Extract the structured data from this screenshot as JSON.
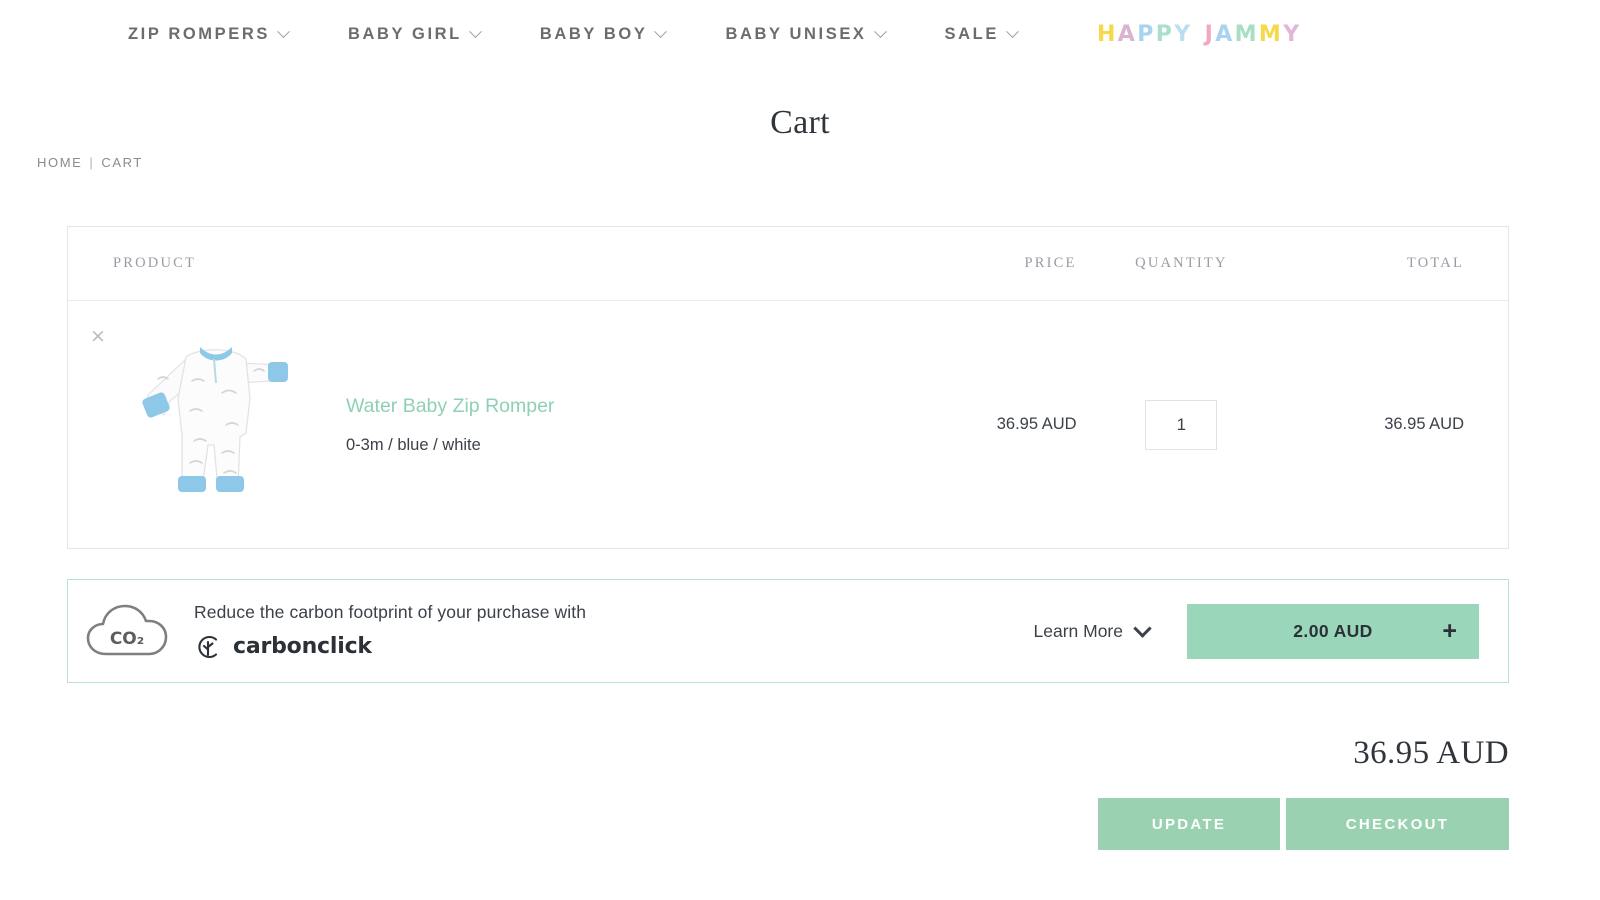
{
  "nav": {
    "items": [
      {
        "label": "ZIP ROMPERS",
        "has_dropdown": true,
        "icon": "chevron-down-icon"
      },
      {
        "label": "BABY GIRL",
        "has_dropdown": true,
        "icon": "chevron-down-icon"
      },
      {
        "label": "BABY BOY",
        "has_dropdown": true,
        "icon": "chevron-down-icon"
      },
      {
        "label": "BABY UNISEX",
        "has_dropdown": true,
        "icon": "chevron-down-icon"
      },
      {
        "label": "SALE",
        "has_dropdown": true,
        "icon": "chevron-down-icon"
      }
    ],
    "brand": {
      "word1": "HAPPY",
      "word2": "JAMMY",
      "letters": [
        {
          "ch": "H",
          "color": "#f5d94b"
        },
        {
          "ch": "A",
          "color": "#d9b3cf"
        },
        {
          "ch": "P",
          "color": "#a8d3ef"
        },
        {
          "ch": "P",
          "color": "#a8e0c9"
        },
        {
          "ch": "Y",
          "color": "#b9dff0"
        },
        {
          "ch": "J",
          "color": "#f2a8be"
        },
        {
          "ch": "A",
          "color": "#a8d3ef"
        },
        {
          "ch": "M",
          "color": "#a8ddc6"
        },
        {
          "ch": "M",
          "color": "#f5d94b"
        },
        {
          "ch": "Y",
          "color": "#e0b7d6"
        }
      ]
    }
  },
  "page": {
    "title": "Cart"
  },
  "breadcrumb": {
    "home": "HOME",
    "separator": "|",
    "current": "CART"
  },
  "cart": {
    "columns": {
      "product": "PRODUCT",
      "price": "PRICE",
      "quantity": "QUANTITY",
      "total": "TOTAL"
    },
    "items": [
      {
        "remove_icon": "close-icon",
        "remove_label": "×",
        "image_alt": "Water Baby Zip Romper thumbnail",
        "name": "Water Baby Zip Romper",
        "variant": "0-3m / blue / white",
        "price": "36.95 AUD",
        "quantity": "1",
        "line_total": "36.95 AUD"
      }
    ]
  },
  "carbon": {
    "icon": "co2-cloud-icon",
    "cloud_label": "CO₂",
    "headline": "Reduce the carbon footprint of your purchase with",
    "brand_name": "carbonclick",
    "brand_icon": "carbonclick-logo-icon",
    "learn_more": "Learn More",
    "learn_more_icon": "chevron-down-icon",
    "offset_amount": "2.00 AUD",
    "offset_plus": "+",
    "offset_plus_icon": "plus-icon"
  },
  "summary": {
    "grand_total": "36.95 AUD",
    "update_label": "UPDATE",
    "checkout_label": "CHECKOUT"
  },
  "colors": {
    "accent_green": "#9ad2b1",
    "offset_green": "#9ad6ba",
    "banner_border": "#b9e2cf",
    "product_link": "#8fd0b5",
    "text_dark": "#3c4148",
    "text_muted": "#9b9aa3",
    "border_light": "#e6e6e6"
  }
}
